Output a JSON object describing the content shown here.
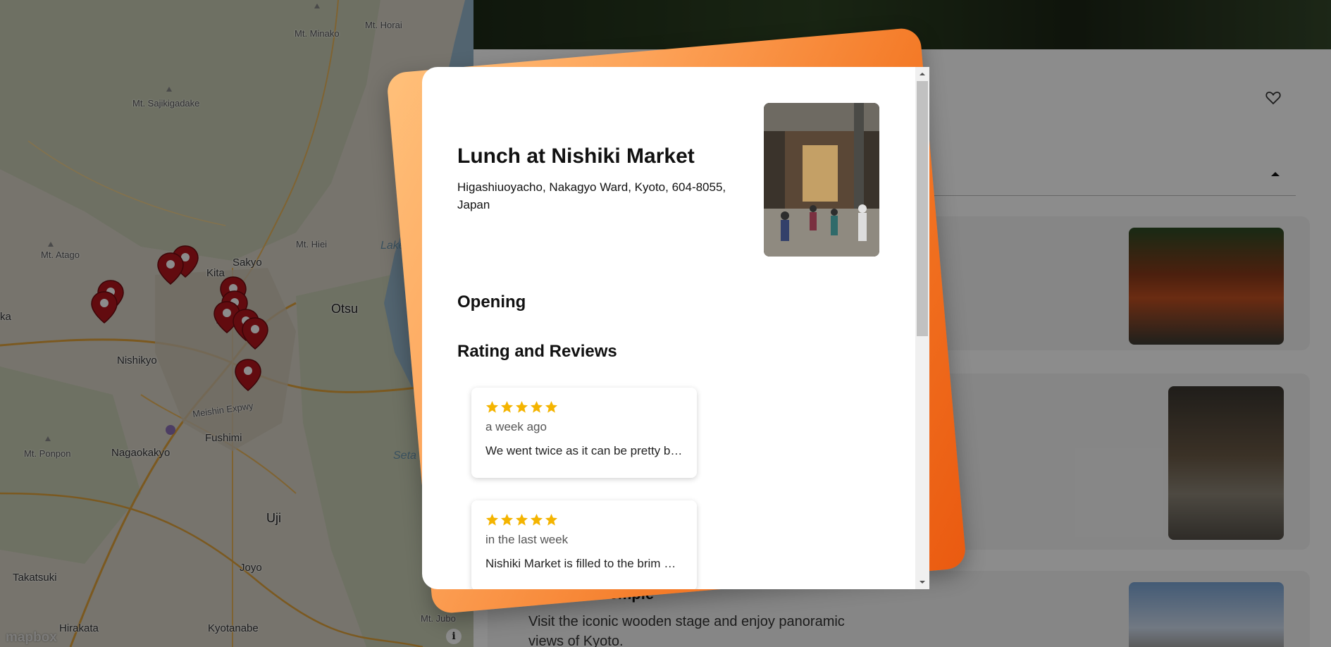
{
  "map": {
    "labels": {
      "mt_minako": "Mt. Minako",
      "mt_horai": "Mt. Horai",
      "mt_sajikigadake": "Mt. Sajikigadake",
      "mt_atago": "Mt. Atago",
      "mt_hiei": "Mt. Hiei",
      "lake": "Lake",
      "sakyo": "Sakyo",
      "kita": "Kita",
      "otsu": "Otsu",
      "ka": "ka",
      "k": "K",
      "nishikyo": "Nishikyo",
      "meishin_expwy": "Meishin Expwy",
      "fushimi": "Fushimi",
      "mt_ponpon": "Mt. Ponpon",
      "nagaokakyo": "Nagaokakyo",
      "seta": "Seta",
      "uji": "Uji",
      "joyo": "Joyo",
      "takatsuki": "Takatsuki",
      "hirakata": "Hirakata",
      "kyotanabe": "Kyotanabe",
      "mt_jubo": "Mt. Jubo"
    },
    "attribution": "mapbox",
    "info_button": "i"
  },
  "panel": {
    "card_title": "...zu-dera Temple",
    "card_description": "Visit the iconic wooden stage and enjoy panoramic views of Kyoto."
  },
  "modal": {
    "title": "Lunch at Nishiki Market",
    "address": "Higashiuoyacho, Nakagyo Ward, Kyoto, 604-8055, Japan",
    "opening_heading": "Opening",
    "reviews_heading": "Rating and Reviews",
    "reviews": [
      {
        "rating": 5,
        "time": "a week ago",
        "text": "We went twice as it can be pretty busy…"
      },
      {
        "rating": 5,
        "time": "in the last week",
        "text": "Nishiki Market is filled to the brim with food…"
      }
    ]
  },
  "colors": {
    "accent_orange": "#f47a27",
    "star": "#f4b400",
    "pin": "#b3151c"
  }
}
